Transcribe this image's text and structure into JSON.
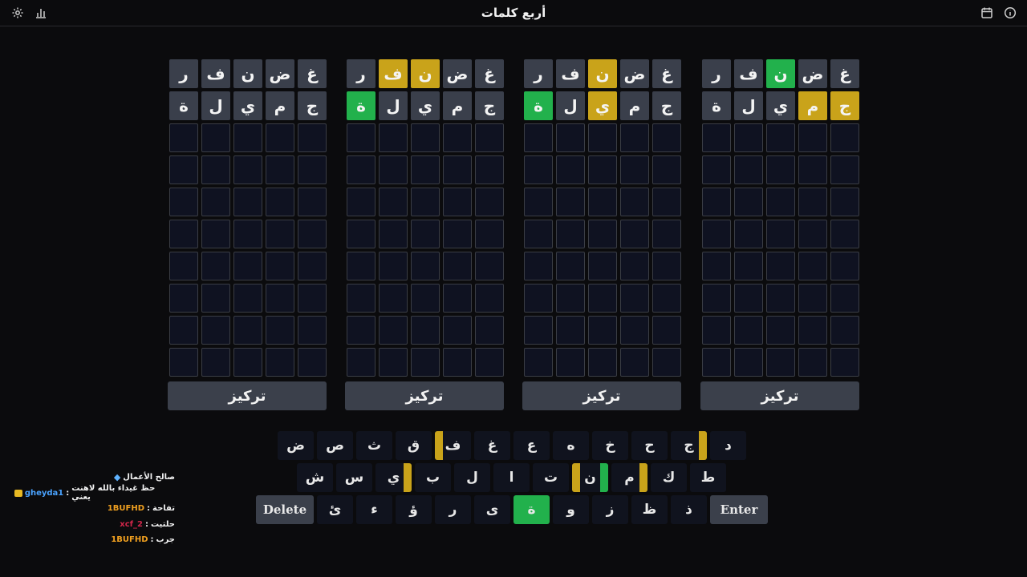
{
  "header": {
    "title": "أربع كلمات"
  },
  "boards": [
    {
      "rows": [
        [
          {
            "l": "غ",
            "s": "filled"
          },
          {
            "l": "ض",
            "s": "filled"
          },
          {
            "l": "ن",
            "s": "filled"
          },
          {
            "l": "ف",
            "s": "filled"
          },
          {
            "l": "ر",
            "s": "filled"
          }
        ],
        [
          {
            "l": "ج",
            "s": "filled"
          },
          {
            "l": "م",
            "s": "filled"
          },
          {
            "l": "ي",
            "s": "filled"
          },
          {
            "l": "ل",
            "s": "filled"
          },
          {
            "l": "ة",
            "s": "filled"
          }
        ]
      ],
      "focus_label": "تركيز"
    },
    {
      "rows": [
        [
          {
            "l": "غ",
            "s": "filled"
          },
          {
            "l": "ض",
            "s": "filled"
          },
          {
            "l": "ن",
            "s": "present"
          },
          {
            "l": "ف",
            "s": "present"
          },
          {
            "l": "ر",
            "s": "filled"
          }
        ],
        [
          {
            "l": "ج",
            "s": "filled"
          },
          {
            "l": "م",
            "s": "filled"
          },
          {
            "l": "ي",
            "s": "filled"
          },
          {
            "l": "ل",
            "s": "filled"
          },
          {
            "l": "ة",
            "s": "correct"
          }
        ]
      ],
      "focus_label": "تركيز"
    },
    {
      "rows": [
        [
          {
            "l": "غ",
            "s": "filled"
          },
          {
            "l": "ض",
            "s": "filled"
          },
          {
            "l": "ن",
            "s": "present"
          },
          {
            "l": "ف",
            "s": "filled"
          },
          {
            "l": "ر",
            "s": "filled"
          }
        ],
        [
          {
            "l": "ج",
            "s": "filled"
          },
          {
            "l": "م",
            "s": "filled"
          },
          {
            "l": "ي",
            "s": "present"
          },
          {
            "l": "ل",
            "s": "filled"
          },
          {
            "l": "ة",
            "s": "correct"
          }
        ]
      ],
      "focus_label": "تركيز"
    },
    {
      "rows": [
        [
          {
            "l": "غ",
            "s": "filled"
          },
          {
            "l": "ض",
            "s": "filled"
          },
          {
            "l": "ن",
            "s": "correct"
          },
          {
            "l": "ف",
            "s": "filled"
          },
          {
            "l": "ر",
            "s": "filled"
          }
        ],
        [
          {
            "l": "ج",
            "s": "present"
          },
          {
            "l": "م",
            "s": "present"
          },
          {
            "l": "ي",
            "s": "filled"
          },
          {
            "l": "ل",
            "s": "filled"
          },
          {
            "l": "ة",
            "s": "filled"
          }
        ]
      ],
      "focus_label": "تركيز"
    }
  ],
  "total_rows": 10,
  "keyboard": {
    "rows": [
      [
        {
          "l": "ض"
        },
        {
          "l": "ص"
        },
        {
          "l": "ث"
        },
        {
          "l": "ق"
        },
        {
          "l": "ف",
          "bands": [
            {
              "side": "left",
              "s": "present"
            }
          ]
        },
        {
          "l": "غ"
        },
        {
          "l": "ع"
        },
        {
          "l": "ه"
        },
        {
          "l": "خ"
        },
        {
          "l": "ح"
        },
        {
          "l": "ج",
          "bands": [
            {
              "side": "right",
              "s": "present"
            }
          ]
        },
        {
          "l": "د"
        }
      ],
      [
        {
          "l": "ش"
        },
        {
          "l": "س"
        },
        {
          "l": "ي",
          "bands": [
            {
              "side": "right",
              "s": "present"
            }
          ]
        },
        {
          "l": "ب"
        },
        {
          "l": "ل"
        },
        {
          "l": "ا"
        },
        {
          "l": "ت"
        },
        {
          "l": "ن",
          "bands": [
            {
              "side": "left",
              "s": "present"
            },
            {
              "side": "right",
              "s": "correct"
            }
          ]
        },
        {
          "l": "م",
          "bands": [
            {
              "side": "right",
              "s": "present"
            }
          ]
        },
        {
          "l": "ك"
        },
        {
          "l": "ط"
        }
      ],
      [
        {
          "l": "Delete",
          "wide": true
        },
        {
          "l": "ئ"
        },
        {
          "l": "ء"
        },
        {
          "l": "ؤ"
        },
        {
          "l": "ر"
        },
        {
          "l": "ى"
        },
        {
          "l": "ة",
          "s": "correct"
        },
        {
          "l": "و"
        },
        {
          "l": "ز"
        },
        {
          "l": "ظ"
        },
        {
          "l": "ذ"
        },
        {
          "l": "Enter",
          "wide": true
        }
      ]
    ]
  },
  "chat": [
    {
      "user": "",
      "user_color": "#f2f2f2",
      "msg": "صالح الأعمال",
      "icon": "diamond-icon"
    },
    {
      "user": "gheyda1",
      "user_color": "#4aa3ff",
      "msg": "حظ غيداء بالله لاهنت يعني",
      "icon": "crown-icon"
    },
    {
      "user": "1BUFHD",
      "user_color": "#f0a020",
      "msg": "تفاحة"
    },
    {
      "user": "xcf_2",
      "user_color": "#d0264a",
      "msg": "حلتيت"
    },
    {
      "user": "1BUFHD",
      "user_color": "#f0a020",
      "msg": "جرب"
    }
  ],
  "colors": {
    "present": "#c9a31a",
    "correct": "#22b14c",
    "filled": "#3a3f4b",
    "empty": "#0f1221"
  }
}
